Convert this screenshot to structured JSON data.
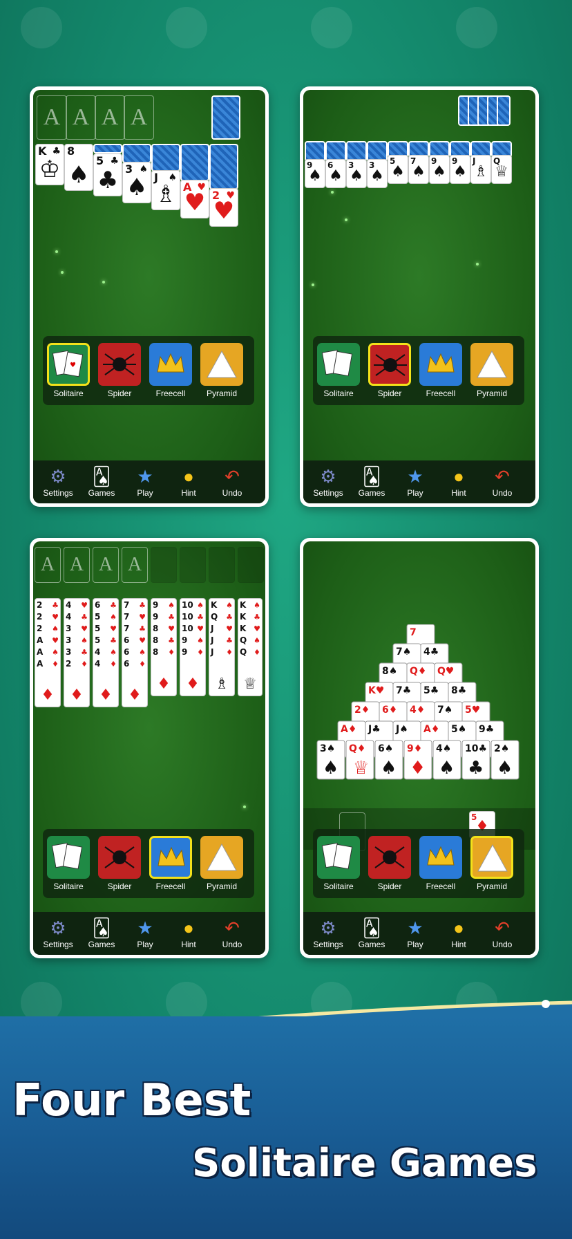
{
  "games": [
    "Solitaire",
    "Spider",
    "Freecell",
    "Pyramid"
  ],
  "tools": [
    "Settings",
    "Games",
    "Play",
    "Hint",
    "Undo"
  ],
  "foundation_letter": "A",
  "headline_line1": "Four Best",
  "headline_line2": "Solitaire Games",
  "icons": [
    "gear-icon",
    "cards-icon",
    "star-plus-icon",
    "bulb-icon",
    "undo-arrow-icon"
  ]
}
